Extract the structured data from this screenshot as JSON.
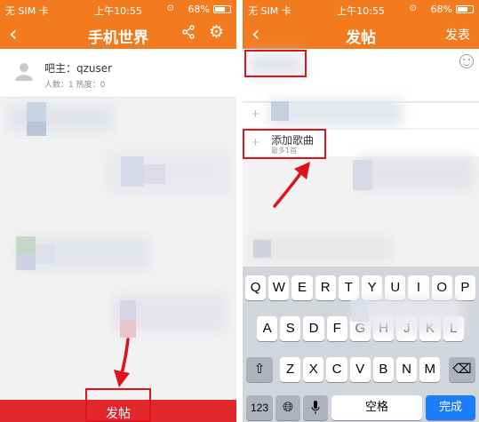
{
  "status_bar": {
    "carrier": "无 SIM 卡 ",
    "time": "上午10:55",
    "battery_pct": "68%",
    "battery_level": 0.68
  },
  "left": {
    "title": "手机世界",
    "owner_label": "吧主：qzuser",
    "stats_label": "人数：1   热度：0",
    "post_button_label": "发帖",
    "icons": [
      "back-icon",
      "share-icon",
      "gear-icon",
      "avatar-icon"
    ]
  },
  "right": {
    "title": "发帖",
    "publish_label": "发表",
    "add_song_label": "添加歌曲",
    "add_song_sub": "最多1首",
    "icons": [
      "back-icon",
      "emoji-icon",
      "plus-icon"
    ]
  },
  "keyboard": {
    "row1": [
      "Q",
      "W",
      "E",
      "R",
      "T",
      "Y",
      "U",
      "I",
      "O",
      "P"
    ],
    "row2": [
      "A",
      "S",
      "D",
      "F",
      "G",
      "H",
      "J",
      "K",
      "L"
    ],
    "row3": [
      "Z",
      "X",
      "C",
      "V",
      "B",
      "N",
      "M"
    ],
    "num_label": "123",
    "space_label": "空格",
    "done_label": "完成",
    "icons": [
      "shift-icon",
      "delete-icon",
      "globe-icon",
      "mic-icon"
    ]
  },
  "colors": {
    "nav": "#f27b1f",
    "post_button": "#e1262c",
    "annotation_red": "#e0121c",
    "done_key": "#1a7efb"
  }
}
